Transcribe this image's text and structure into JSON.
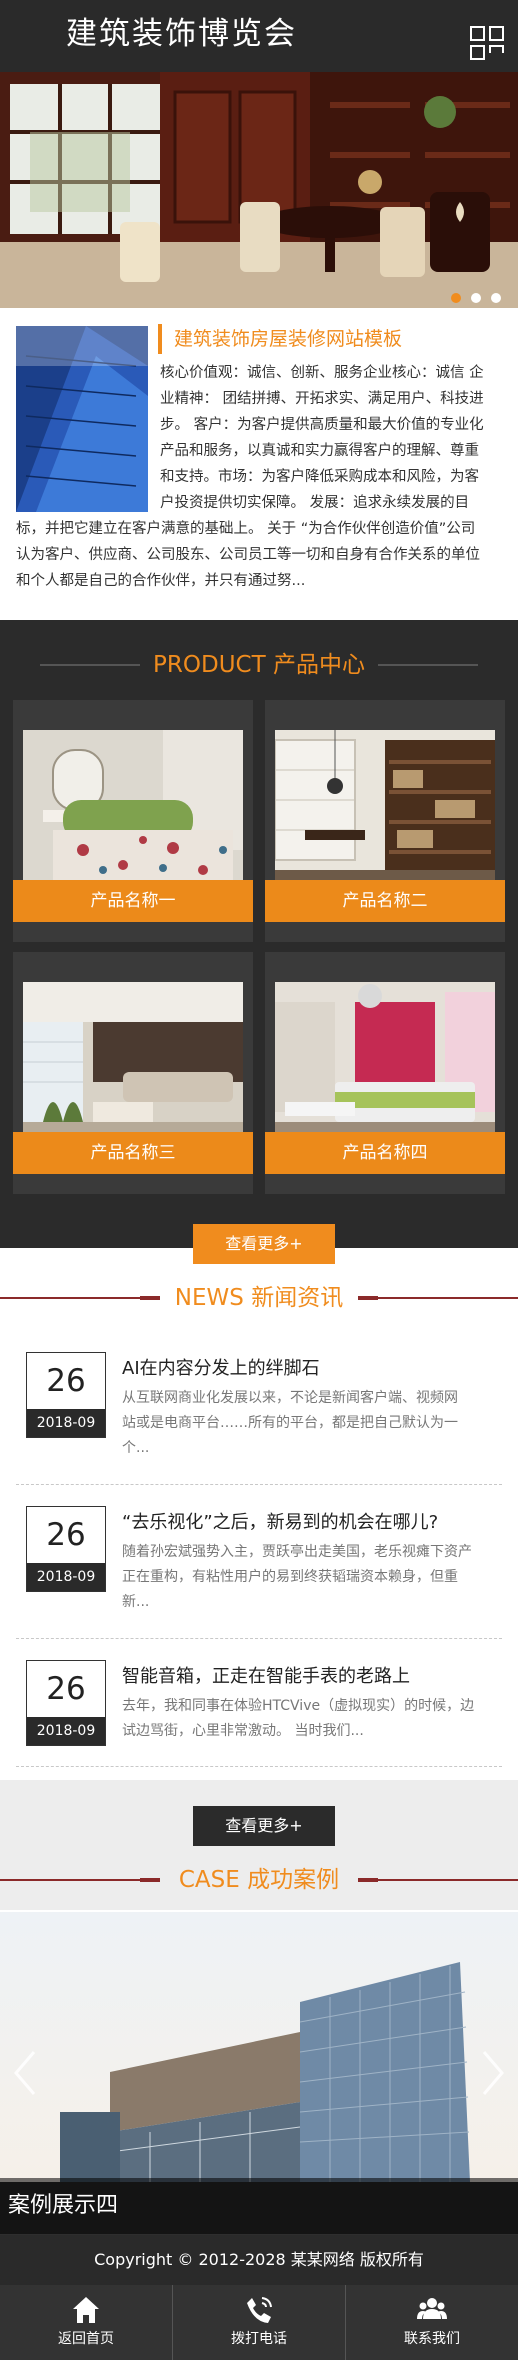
{
  "header": {
    "title": "建筑装饰博览会",
    "menu_icon": "grid-menu-icon"
  },
  "banner": {
    "slides": 3,
    "active_slide": 1
  },
  "about": {
    "title": "建筑装饰房屋装修网站模板",
    "lines": [
      "核心价值观：诚信、创新、服务企业核心：诚信 企",
      "业精神： 团结拼搏、开拓求实、满足用户、科技进",
      "步。 客户：为客户提供高质量和最大价值的专业化",
      "产品和服务，以真诚和实力赢得客户的理解、尊重",
      "和支持。市场：为客户降低采购成本和风险，为客",
      "户投资提供切实保障。 发展：追求永续发展的目",
      "标，并把它建立在客户满意的基础上。 关于 “为合作伙伴创造价值”公司",
      "认为客户、供应商、公司股东、公司员工等一切和自身有合作关系的单位",
      "和个人都是自己的合作伙伴，并只有通过努..."
    ]
  },
  "product": {
    "title_en": "PRODUCT",
    "title_cn": "产品中心",
    "items": [
      "产品名称一",
      "产品名称二",
      "产品名称三",
      "产品名称四"
    ],
    "more": "查看更多+"
  },
  "news": {
    "title_en": "NEWS",
    "title_cn": "新闻资讯",
    "items": [
      {
        "day": "26",
        "ym": "2018-09",
        "title": "AI在内容分发上的绊脚石",
        "lines": [
          "从互联网商业化发展以来，不论是新闻客户端、视频网",
          "站或是电商平台……所有的平台，都是把自己默认为一",
          "个..."
        ]
      },
      {
        "day": "26",
        "ym": "2018-09",
        "title": "“去乐视化”之后，新易到的机会在哪儿?",
        "lines": [
          "随着孙宏斌强势入主，贾跃亭出走美国，老乐视瘫下资产",
          "正在重构，有粘性用户的易到终获韬瑞资本赖身，但重",
          "新..."
        ]
      },
      {
        "day": "26",
        "ym": "2018-09",
        "title": "智能音箱，正走在智能手表的老路上",
        "lines": [
          "去年，我和同事在体验HTCVive（虚拟现实）的时候，边",
          "试边骂街，心里非常激动。 当时我们..."
        ]
      }
    ],
    "more": "查看更多+"
  },
  "case": {
    "title_en": "CASE",
    "title_cn": "成功案例",
    "caption": "案例展示四"
  },
  "copyright": "Copyright © 2012-2028 某某网络 版权所有",
  "footer": {
    "items": [
      {
        "label": "返回首页",
        "icon": "home-icon"
      },
      {
        "label": "拨打电话",
        "icon": "phone-icon"
      },
      {
        "label": "联系我们",
        "icon": "contacts-icon"
      }
    ]
  },
  "colors": {
    "accent": "#f08c1e",
    "dark": "#2a2a2a",
    "product_bg": "#2b2b2b",
    "case_line": "#8b2a2a"
  }
}
